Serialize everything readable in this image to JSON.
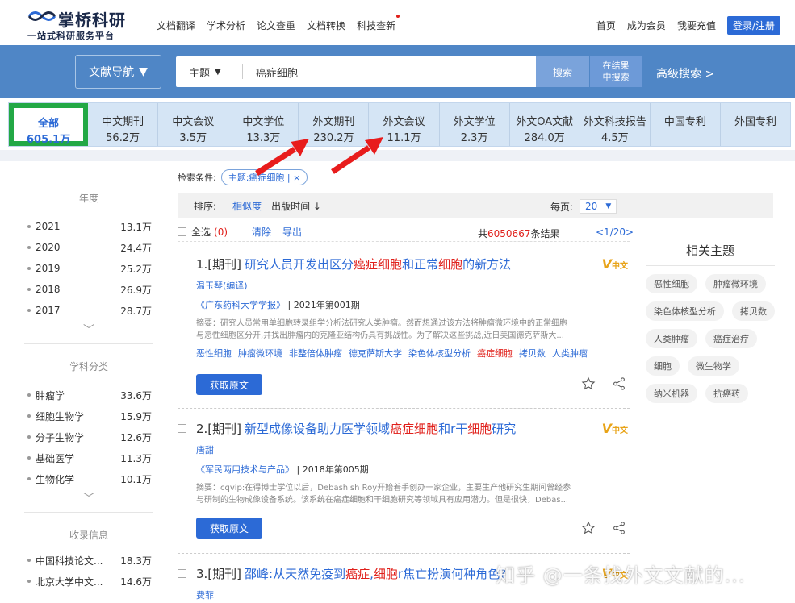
{
  "logo": {
    "name": "掌桥科研",
    "slogan": "一站式科研服务平台"
  },
  "topnav": [
    "文档翻译",
    "学术分析",
    "论文查重",
    "文档转换",
    "科技查新"
  ],
  "topright": {
    "home": "首页",
    "member": "成为会员",
    "recharge": "我要充值",
    "login": "登录/注册"
  },
  "search": {
    "nav_label": "文献导航",
    "field": "主题",
    "query": "癌症细胞",
    "button": "搜索",
    "in_result_line1": "在结果",
    "in_result_line2": "中搜索",
    "advanced": "高级搜索 >"
  },
  "tabs": [
    {
      "label": "全部",
      "count": "605.1万"
    },
    {
      "label": "中文期刊",
      "count": "56.2万"
    },
    {
      "label": "中文会议",
      "count": "3.5万"
    },
    {
      "label": "中文学位",
      "count": "13.3万"
    },
    {
      "label": "外文期刊",
      "count": "230.2万"
    },
    {
      "label": "外文会议",
      "count": "11.1万"
    },
    {
      "label": "外文学位",
      "count": "2.3万"
    },
    {
      "label": "外文OA文献",
      "count": "284.0万"
    },
    {
      "label": "外文科技报告",
      "count": "4.5万"
    },
    {
      "label": "中国专利",
      "count": ""
    },
    {
      "label": "外国专利",
      "count": ""
    }
  ],
  "sidebar": {
    "year_title": "年度",
    "years": [
      {
        "label": "2021",
        "count": "13.1万"
      },
      {
        "label": "2020",
        "count": "24.4万"
      },
      {
        "label": "2019",
        "count": "25.2万"
      },
      {
        "label": "2018",
        "count": "26.9万"
      },
      {
        "label": "2017",
        "count": "28.7万"
      }
    ],
    "subject_title": "学科分类",
    "subjects": [
      {
        "label": "肿瘤学",
        "count": "33.6万"
      },
      {
        "label": "细胞生物学",
        "count": "15.9万"
      },
      {
        "label": "分子生物学",
        "count": "12.6万"
      },
      {
        "label": "基础医学",
        "count": "11.3万"
      },
      {
        "label": "生物化学",
        "count": "10.1万"
      }
    ],
    "index_title": "收录信息",
    "indexes": [
      {
        "label": "中国科技论文...",
        "count": "18.3万"
      },
      {
        "label": "北京大学中文...",
        "count": "14.6万"
      }
    ]
  },
  "conditions": {
    "label": "检索条件:",
    "chip": "主题:癌症细胞",
    "chip_close": "×"
  },
  "sortbar": {
    "label": "排序:",
    "similarity": "相似度",
    "pub_time": "出版时间 ↓",
    "per_page_label": "每页:",
    "per_page": "20"
  },
  "selectbar": {
    "select_all": "全选",
    "selected_count": "(0)",
    "clear": "清除",
    "export": "导出",
    "total_prefix": "共",
    "total": "6050667",
    "total_suffix": "条结果",
    "pager": "<1/20>"
  },
  "results": [
    {
      "prefix": "1.[期刊]",
      "title_parts": [
        {
          "text": "研究人员开发出区分",
          "hl": false
        },
        {
          "text": "癌症细胞",
          "hl": true
        },
        {
          "text": "和正常",
          "hl": false
        },
        {
          "text": "细胞",
          "hl": true
        },
        {
          "text": "的新方法",
          "hl": false
        }
      ],
      "badge": "中文",
      "author": "温玉琴(编译)",
      "source": "《广东药科大学学报》",
      "issue": "| 2021年第001期",
      "abstract_line1": "摘要：研究人员常用单细胞转录组学分析法研究人类肿瘤。然而想通过该方法将肿瘤微环境中的正常细胞",
      "abstract_line2": "与恶性细胞区分开,并找出肿瘤内的克隆亚结构仍具有挑战性。为了解决这些挑战,近日美国德克萨斯大...",
      "keywords": [
        {
          "text": "恶性细胞",
          "hl": false
        },
        {
          "text": "肿瘤微环境",
          "hl": false
        },
        {
          "text": "非整倍体肿瘤",
          "hl": false
        },
        {
          "text": "德克萨斯大学",
          "hl": false
        },
        {
          "text": "染色体核型分析",
          "hl": false
        },
        {
          "text": "癌症细胞",
          "hl": true
        },
        {
          "text": "拷贝数",
          "hl": false
        },
        {
          "text": "人类肿瘤",
          "hl": false
        }
      ],
      "button": "获取原文"
    },
    {
      "prefix": "2.[期刊]",
      "title_parts": [
        {
          "text": "新型成像设备助力医学领域",
          "hl": false
        },
        {
          "text": "癌症细胞",
          "hl": true
        },
        {
          "text": "和r干",
          "hl": false
        },
        {
          "text": "细胞",
          "hl": true
        },
        {
          "text": "研究",
          "hl": false
        }
      ],
      "badge": "中文",
      "author": "唐甜",
      "source": "《军民两用技术与产品》",
      "issue": "| 2018年第005期",
      "abstract_line1": "摘要：cqvip:在得博士学位以后，Debashish Roy开始着手创办一家企业，主要生产他研究生期间曾经参",
      "abstract_line2": "与研制的生物成像设备系统。该系统在癌症细胞和干细胞研究等领域具有应用潜力。但是很快，Debas...",
      "keywords": [],
      "button": "获取原文"
    },
    {
      "prefix": "3.[期刊]",
      "title_parts": [
        {
          "text": "邵峰:从天然免疫到",
          "hl": false
        },
        {
          "text": "癌症",
          "hl": true
        },
        {
          "text": ",",
          "hl": false
        },
        {
          "text": "细胞",
          "hl": true
        },
        {
          "text": "r焦亡扮演何种角色?",
          "hl": false
        }
      ],
      "badge": "中文",
      "author": "费菲",
      "source": "",
      "issue": "",
      "abstract_line1": "",
      "abstract_line2": "",
      "keywords": [],
      "button": ""
    }
  ],
  "related": {
    "title": "相关主题",
    "tags": [
      "恶性细胞",
      "肿瘤微环境",
      "染色体核型分析",
      "拷贝数",
      "人类肿瘤",
      "癌症治疗",
      "细胞",
      "微生物学",
      "纳米机器",
      "抗癌药"
    ]
  },
  "watermark": "知乎 @一条找外文文献的...",
  "colors": {
    "accent": "#2c6ad6",
    "highlight": "#e0201b",
    "band": "#4f86c6",
    "tabs_bg": "#d5e5f5",
    "active_border": "#22a845",
    "arrow": "#e81c1c",
    "vip": "#e8a317"
  }
}
